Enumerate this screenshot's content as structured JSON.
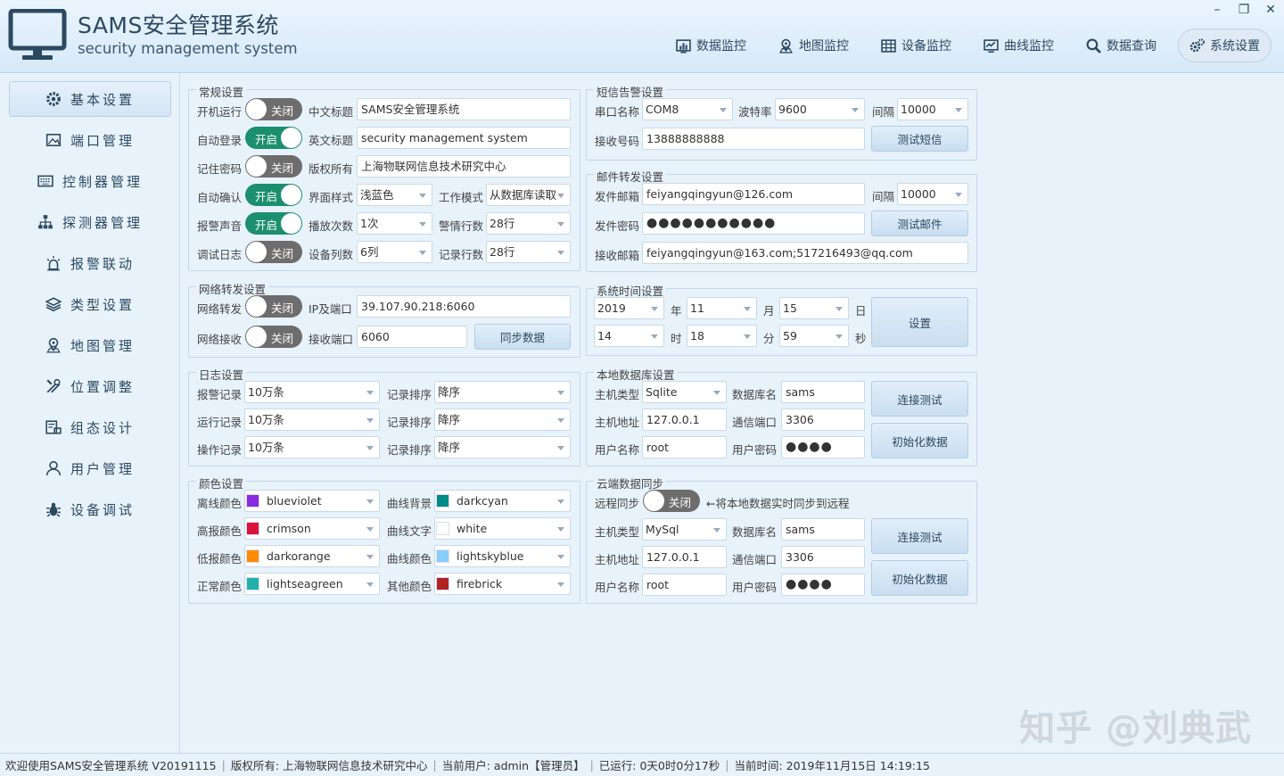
{
  "app": {
    "title": "SAMS安全管理系统",
    "subtitle": "security management system",
    "window_controls": [
      "–",
      "❐",
      "✕"
    ]
  },
  "nav": [
    {
      "label": "数据监控",
      "icon": "bar-chart-icon"
    },
    {
      "label": "地图监控",
      "icon": "map-pin-icon"
    },
    {
      "label": "设备监控",
      "icon": "grid-icon"
    },
    {
      "label": "曲线监控",
      "icon": "line-chart-icon"
    },
    {
      "label": "数据查询",
      "icon": "search-icon"
    },
    {
      "label": "系统设置",
      "icon": "gears-icon",
      "active": true
    }
  ],
  "sidebar": [
    {
      "label": "基本设置",
      "icon": "gear-icon",
      "active": true
    },
    {
      "label": "端口管理",
      "icon": "image-icon"
    },
    {
      "label": "控制器管理",
      "icon": "keyboard-icon"
    },
    {
      "label": "探测器管理",
      "icon": "sitemap-icon"
    },
    {
      "label": "报警联动",
      "icon": "alarm-light-icon"
    },
    {
      "label": "类型设置",
      "icon": "layers-icon"
    },
    {
      "label": "地图管理",
      "icon": "map-pin-icon"
    },
    {
      "label": "位置调整",
      "icon": "tools-icon"
    },
    {
      "label": "组态设计",
      "icon": "design-icon"
    },
    {
      "label": "用户管理",
      "icon": "user-icon"
    },
    {
      "label": "设备调试",
      "icon": "bug-icon"
    }
  ],
  "general": {
    "title": "常规设置",
    "autostart": {
      "label": "开机运行",
      "state": "关闭"
    },
    "cn_title": {
      "label": "中文标题",
      "value": "SAMS安全管理系统"
    },
    "autologin": {
      "label": "自动登录",
      "state": "开启"
    },
    "en_title": {
      "label": "英文标题",
      "value": "security management system"
    },
    "remember": {
      "label": "记住密码",
      "state": "关闭"
    },
    "copyright": {
      "label": "版权所有",
      "value": "上海物联网信息技术研究中心"
    },
    "autoconfirm": {
      "label": "自动确认",
      "state": "开启"
    },
    "ui_style": {
      "label": "界面样式",
      "value": "浅蓝色"
    },
    "work_mode": {
      "label": "工作模式",
      "value": "从数据库读取"
    },
    "alarm_sound": {
      "label": "报警声音",
      "state": "开启"
    },
    "play_count": {
      "label": "播放次数",
      "value": "1次"
    },
    "alarm_rows": {
      "label": "警情行数",
      "value": "28行"
    },
    "debug_log": {
      "label": "调试日志",
      "state": "关闭"
    },
    "device_cols": {
      "label": "设备列数",
      "value": "6列"
    },
    "record_rows": {
      "label": "记录行数",
      "value": "28行"
    }
  },
  "network": {
    "title": "网络转发设置",
    "forward": {
      "label": "网络转发",
      "state": "关闭"
    },
    "ip": {
      "label": "IP及端口",
      "value": "39.107.90.218:6060"
    },
    "receive": {
      "label": "网络接收",
      "state": "关闭"
    },
    "recv_port": {
      "label": "接收端口",
      "value": "6060"
    },
    "sync_button": "同步数据"
  },
  "log": {
    "title": "日志设置",
    "rows": [
      {
        "label": "报警记录",
        "value": "10万条",
        "sort_label": "记录排序",
        "sort": "降序"
      },
      {
        "label": "运行记录",
        "value": "10万条",
        "sort_label": "记录排序",
        "sort": "降序"
      },
      {
        "label": "操作记录",
        "value": "10万条",
        "sort_label": "记录排序",
        "sort": "降序"
      }
    ]
  },
  "colors": {
    "title": "颜色设置",
    "rows": [
      {
        "label": "离线颜色",
        "name": "blueviolet",
        "hex": "#8a2be2",
        "label2": "曲线背景",
        "name2": "darkcyan",
        "hex2": "#008b8b"
      },
      {
        "label": "高报颜色",
        "name": "crimson",
        "hex": "#dc143c",
        "label2": "曲线文字",
        "name2": "white",
        "hex2": "#ffffff"
      },
      {
        "label": "低报颜色",
        "name": "darkorange",
        "hex": "#ff8c00",
        "label2": "曲线颜色",
        "name2": "lightskyblue",
        "hex2": "#87cefa"
      },
      {
        "label": "正常颜色",
        "name": "lightseagreen",
        "hex": "#20b2aa",
        "label2": "其他颜色",
        "name2": "firebrick",
        "hex2": "#b22222"
      }
    ]
  },
  "sms": {
    "title": "短信告警设置",
    "port": {
      "label": "串口名称",
      "value": "COM8"
    },
    "baud": {
      "label": "波特率",
      "value": "9600"
    },
    "interval": {
      "label": "间隔",
      "value": "10000"
    },
    "recv": {
      "label": "接收号码",
      "value": "13888888888"
    },
    "test_button": "测试短信"
  },
  "mail": {
    "title": "邮件转发设置",
    "sender": {
      "label": "发件邮箱",
      "value": "feiyangqingyun@126.com"
    },
    "interval": {
      "label": "间隔",
      "value": "10000"
    },
    "password": {
      "label": "发件密码",
      "value": "●●●●●●●●●●●"
    },
    "test_button": "测试邮件",
    "recv": {
      "label": "接收邮箱",
      "value": "feiyangqingyun@163.com;517216493@qq.com"
    }
  },
  "time": {
    "title": "系统时间设置",
    "year": "2019",
    "year_unit": "年",
    "month": "11",
    "month_unit": "月",
    "day": "15",
    "day_unit": "日",
    "hour": "14",
    "hour_unit": "时",
    "minute": "18",
    "minute_unit": "分",
    "second": "59",
    "second_unit": "秒",
    "set_button": "设置"
  },
  "localdb": {
    "title": "本地数据库设置",
    "type": {
      "label": "主机类型",
      "value": "Sqlite"
    },
    "dbname": {
      "label": "数据库名",
      "value": "sams"
    },
    "host": {
      "label": "主机地址",
      "value": "127.0.0.1"
    },
    "port": {
      "label": "通信端口",
      "value": "3306"
    },
    "user": {
      "label": "用户名称",
      "value": "root"
    },
    "pwd": {
      "label": "用户密码",
      "value": "●●●●"
    },
    "test_button": "连接测试",
    "init_button": "初始化数据"
  },
  "cloud": {
    "title": "云端数据同步",
    "sync": {
      "label": "远程同步",
      "state": "关闭",
      "hint": "←将本地数据实时同步到远程"
    },
    "type": {
      "label": "主机类型",
      "value": "MySql"
    },
    "dbname": {
      "label": "数据库名",
      "value": "sams"
    },
    "host": {
      "label": "主机地址",
      "value": "127.0.0.1"
    },
    "port": {
      "label": "通信端口",
      "value": "3306"
    },
    "user": {
      "label": "用户名称",
      "value": "root"
    },
    "pwd": {
      "label": "用户密码",
      "value": "●●●●"
    },
    "test_button": "连接测试",
    "init_button": "初始化数据"
  },
  "status": {
    "welcome": "欢迎使用SAMS安全管理系统 V20191115",
    "copyright": "版权所有: 上海物联网信息技术研究中心",
    "user": "当前用户: admin【管理员】",
    "uptime": "已运行: 0天0时0分17秒",
    "now": "当前时间: 2019年11月15日 14:19:15"
  },
  "watermark": "知乎 @刘典武"
}
